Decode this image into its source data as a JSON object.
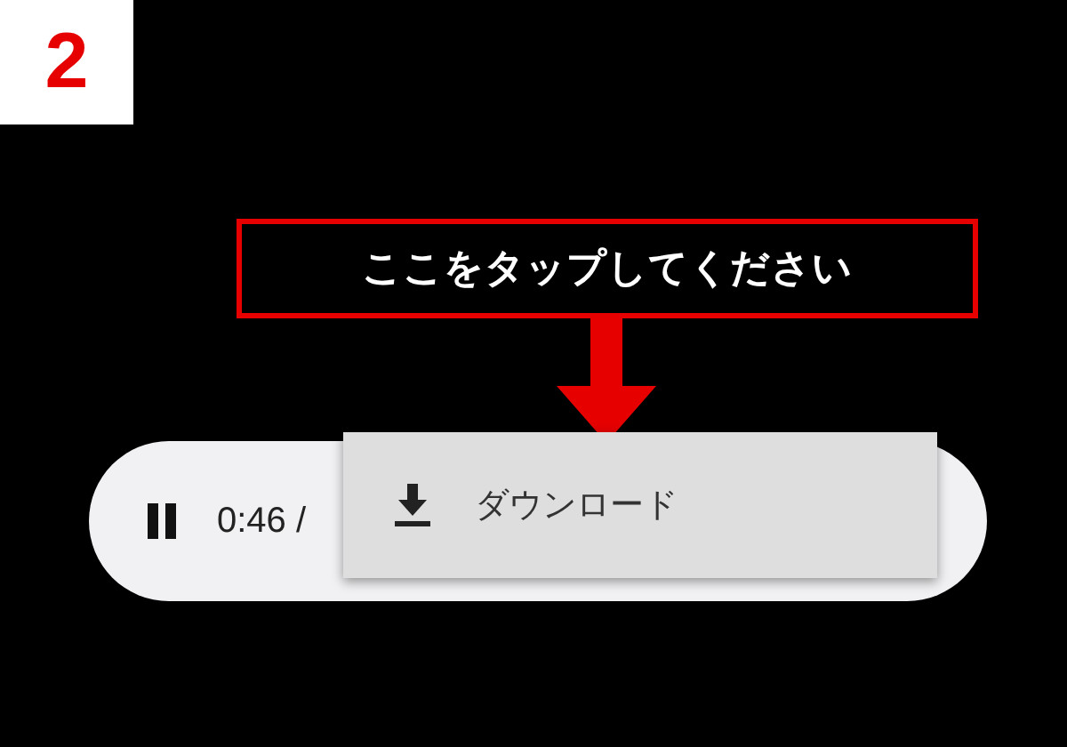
{
  "step_badge": {
    "number": "2"
  },
  "callout": {
    "text": "ここをタップしてください"
  },
  "player": {
    "playing": true,
    "time": "0:46 /"
  },
  "menu": {
    "items": [
      {
        "label": "ダウンロード"
      }
    ]
  }
}
